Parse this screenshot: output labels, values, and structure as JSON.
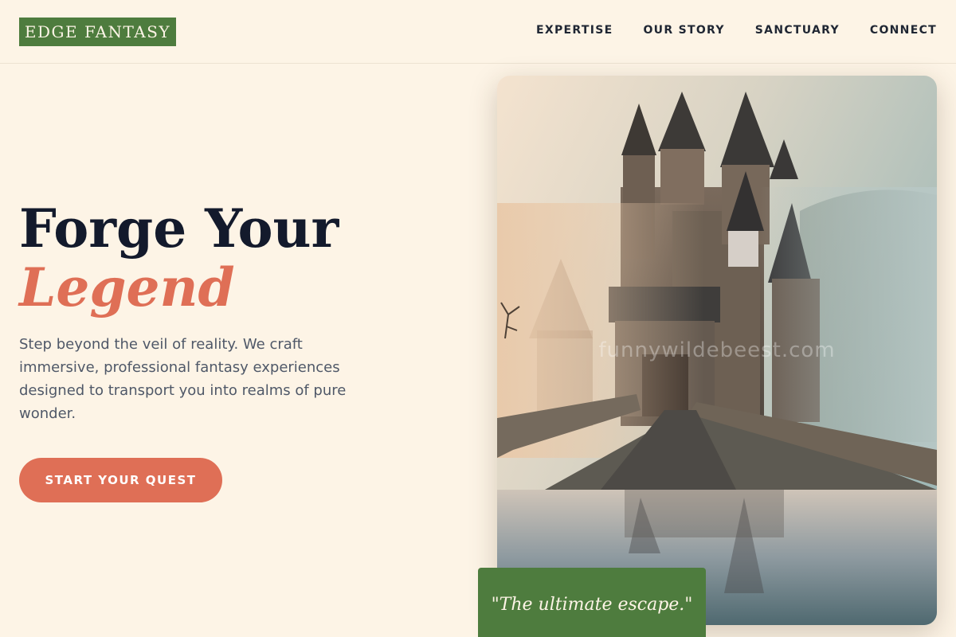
{
  "brand": {
    "logo_text": "EDGE FANTASY"
  },
  "nav": {
    "items": [
      "EXPERTISE",
      "OUR STORY",
      "SANCTUARY",
      "CONNECT"
    ]
  },
  "hero": {
    "title_line1": "Forge Your",
    "title_line2": "Legend",
    "description": "Step beyond the veil of reality. We craft immersive, professional fantasy experiences designed to transport you into realms of pure wonder.",
    "cta_label": "START YOUR QUEST"
  },
  "photo": {
    "watermark": "funnywildebeest.com"
  },
  "quote": {
    "text": "\"The ultimate escape.\""
  },
  "colors": {
    "background": "#fdf4e6",
    "brand_green": "#4e7c3e",
    "accent_coral": "#df6f56",
    "heading": "#131a2c",
    "body_text": "#4f5868"
  }
}
